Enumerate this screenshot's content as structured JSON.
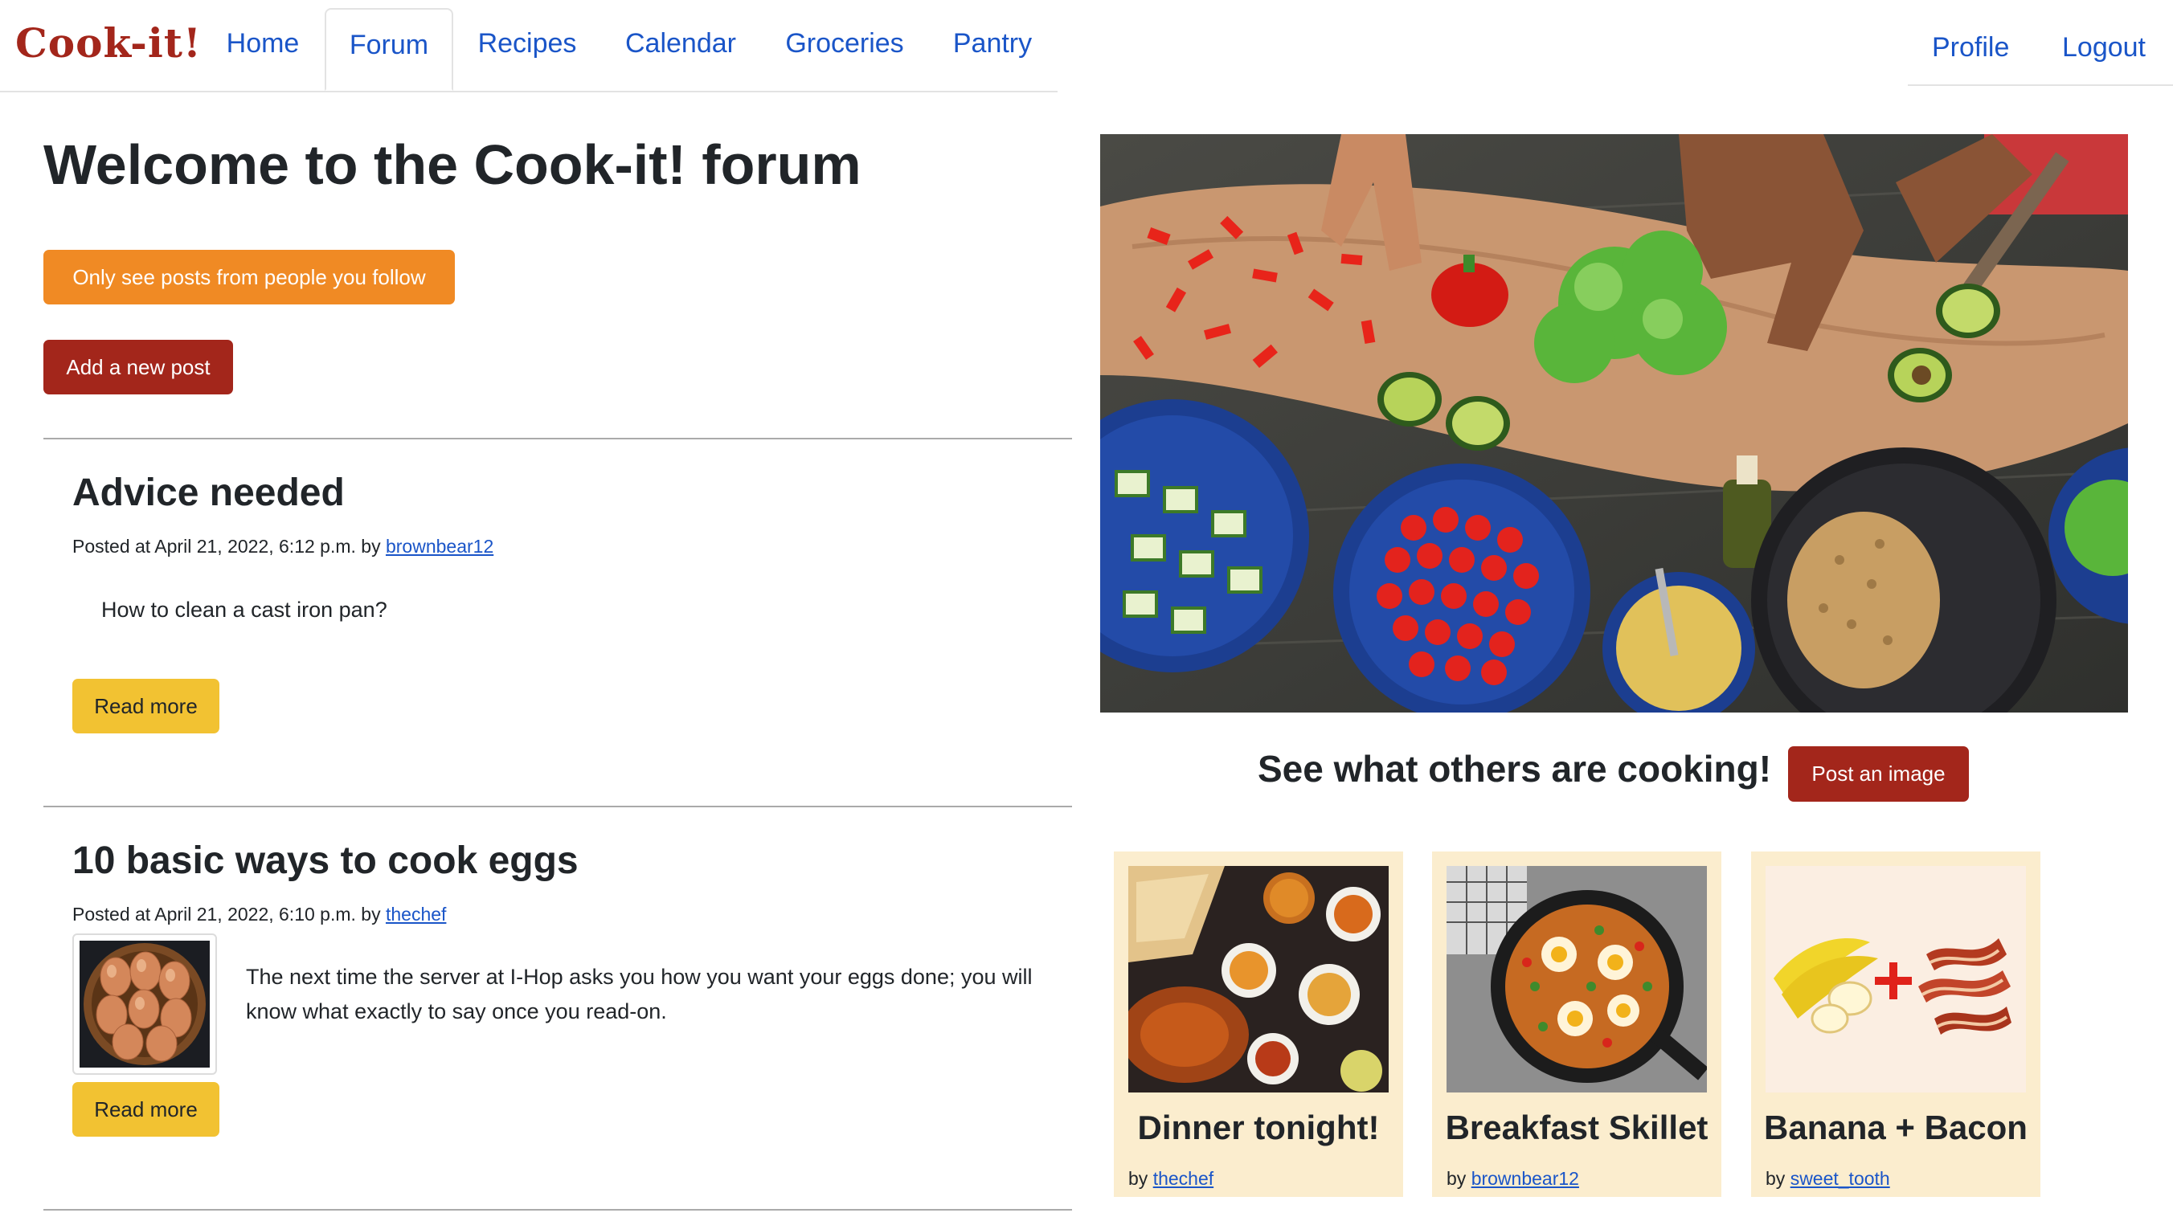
{
  "nav": {
    "brand": "Cook-it!",
    "tabs": [
      {
        "label": "Home"
      },
      {
        "label": "Forum"
      },
      {
        "label": "Recipes"
      },
      {
        "label": "Calendar"
      },
      {
        "label": "Groceries"
      },
      {
        "label": "Pantry"
      }
    ],
    "active_tab": "Forum",
    "profile_label": "Profile",
    "logout_label": "Logout"
  },
  "main": {
    "title": "Welcome to the Cook-it! forum",
    "follow_filter_label": "Only see posts from people you follow",
    "new_post_label": "Add a new post"
  },
  "posts": [
    {
      "title": "Advice needed",
      "meta_prefix": "Posted at April 21, 2022, 6:12 p.m. by",
      "author": "brownbear12",
      "body": "How to clean a cast iron pan?",
      "read_more": "Read more"
    },
    {
      "title": "10 basic ways to cook eggs",
      "meta_prefix": "Posted at April 21, 2022, 6:10 p.m. by",
      "author": "thechef",
      "body": "The next time the server at I-Hop asks you how you want your eggs done; you will know what exactly to say once you read-on.",
      "read_more": "Read more"
    }
  ],
  "gallery": {
    "heading": "See what others are cooking!",
    "post_image_label": "Post an image",
    "cards": [
      {
        "title": "Dinner tonight!",
        "by_prefix": "by",
        "author": "thechef"
      },
      {
        "title": "Breakfast Skillet",
        "by_prefix": "by",
        "author": "brownbear12"
      },
      {
        "title": "Banana + Bacon",
        "by_prefix": "by",
        "author": "sweet_tooth"
      }
    ]
  },
  "colors": {
    "brand": "#a3261b",
    "link": "#1a55c8",
    "orange": "#f08a24",
    "yellow": "#f2c232",
    "card_bg": "#fbedce"
  }
}
